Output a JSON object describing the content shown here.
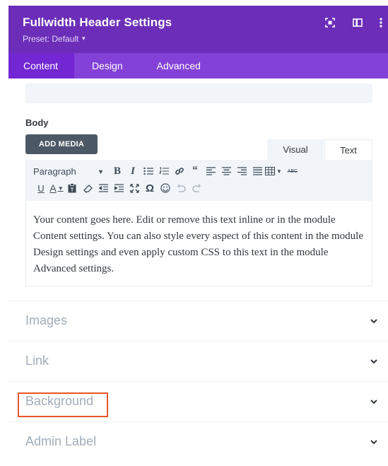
{
  "header": {
    "title": "Fullwidth Header Settings",
    "preset_label": "Preset: Default",
    "icons": [
      "expand-icon",
      "split-view-icon",
      "more-options-icon"
    ],
    "color": "#6c2eb9"
  },
  "tabs": [
    {
      "label": "Content",
      "active": true
    },
    {
      "label": "Design",
      "active": false
    },
    {
      "label": "Advanced",
      "active": false
    }
  ],
  "body_section": {
    "label": "Body",
    "add_media": "ADD MEDIA",
    "editor_tabs": {
      "visual": "Visual",
      "text": "Text"
    },
    "toolbar": {
      "format_select": "Paragraph",
      "row1_icons": [
        "bold-icon",
        "italic-icon",
        "bullet-list-icon",
        "numbered-list-icon",
        "link-icon",
        "blockquote-icon",
        "align-left-icon",
        "align-center-icon",
        "align-right-icon",
        "align-justify-icon",
        "table-icon",
        "strikethrough-icon"
      ],
      "row2_icons": [
        "underline-icon",
        "text-color-icon",
        "paste-text-icon",
        "clear-formatting-icon",
        "outdent-icon",
        "indent-icon",
        "fullscreen-icon",
        "special-character-icon",
        "emoji-icon",
        "undo-icon",
        "redo-icon"
      ]
    },
    "content": "Your content goes here. Edit or remove this text inline or in the module Content settings. You can also style every aspect of this content in the module Design settings and even apply custom CSS to this text in the module Advanced settings."
  },
  "accordions": [
    {
      "label": "Images"
    },
    {
      "label": "Link"
    },
    {
      "label": "Background",
      "highlighted": true
    },
    {
      "label": "Admin Label"
    }
  ],
  "colors": {
    "header": "#6c2eb9",
    "tabs": "#8341d8",
    "active_tab": "#7227d3",
    "highlight": "#e8552a"
  }
}
